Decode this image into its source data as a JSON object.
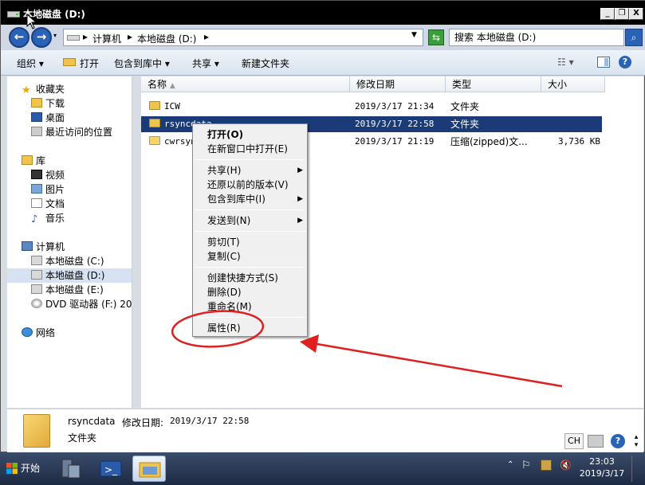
{
  "window": {
    "title": "本地磁盘 (D:)",
    "buttons": {
      "minimize": "_",
      "restore": "❐",
      "close": "X"
    }
  },
  "address": {
    "crumbs": [
      "计算机",
      "本地磁盘 (D:)"
    ],
    "search_placeholder": "搜索 本地磁盘 (D:)"
  },
  "toolbar": {
    "organize": "组织 ▾",
    "open": "打开",
    "include_library": "包含到库中 ▾",
    "share": "共享 ▾",
    "new_folder": "新建文件夹"
  },
  "nav": {
    "favorites": "收藏夹",
    "downloads": "下载",
    "desktop": "桌面",
    "recent": "最近访问的位置",
    "libraries": "库",
    "videos": "视频",
    "pictures": "图片",
    "documents": "文档",
    "music": "音乐",
    "computer": "计算机",
    "drive_c": "本地磁盘 (C:)",
    "drive_d": "本地磁盘 (D:)",
    "drive_e": "本地磁盘 (E:)",
    "drive_f": "DVD 驱动器 (F:) 20",
    "network": "网络"
  },
  "columns": {
    "name": "名称",
    "date": "修改日期",
    "type": "类型",
    "size": "大小"
  },
  "files": [
    {
      "name": "ICW",
      "date": "2019/3/17 21:34",
      "type": "文件夹",
      "size": ""
    },
    {
      "name": "rsyncdata",
      "date": "2019/3/17 22:58",
      "type": "文件夹",
      "size": ""
    },
    {
      "name": "cwrsyn",
      "date": "2019/3/17 21:19",
      "type": "压缩(zipped)文...",
      "size": "3,736 KB"
    }
  ],
  "context_menu": {
    "open": "打开(O)",
    "open_new_window": "在新窗口中打开(E)",
    "share": "共享(H)",
    "restore_versions": "还原以前的版本(V)",
    "include_library": "包含到库中(I)",
    "send_to": "发送到(N)",
    "cut": "剪切(T)",
    "copy": "复制(C)",
    "create_shortcut": "创建快捷方式(S)",
    "delete": "删除(D)",
    "rename": "重命名(M)",
    "properties": "属性(R)"
  },
  "details": {
    "name": "rsyncdata",
    "modified_label": "修改日期:",
    "modified_value": "2019/3/17 22:58",
    "type": "文件夹"
  },
  "taskbar": {
    "start": "开始",
    "lang": "CH",
    "time": "23:03",
    "date": "2019/3/17"
  },
  "colors": {
    "selection": "#1b3b78",
    "annotation": "#e02020"
  }
}
